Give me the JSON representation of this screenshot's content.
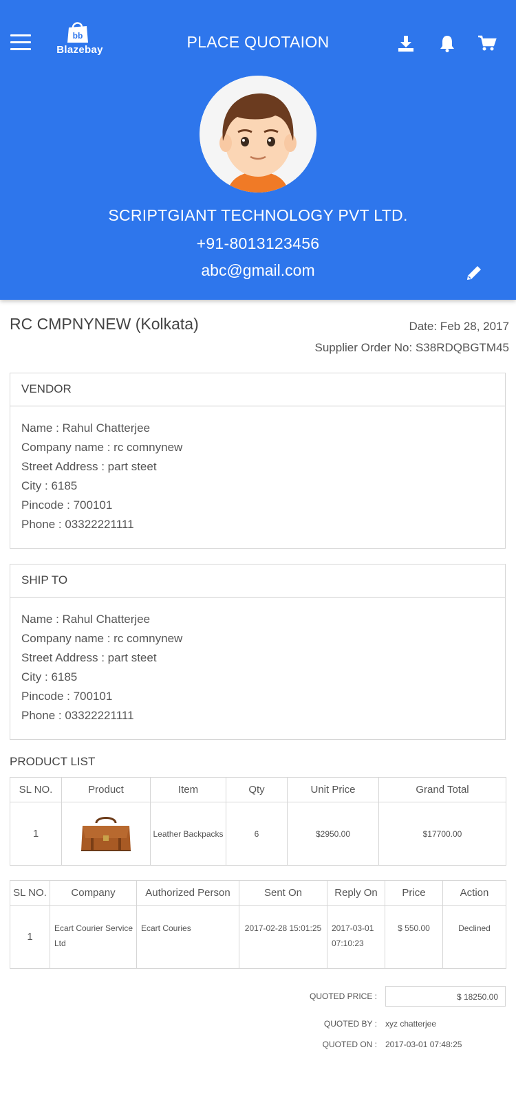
{
  "app": {
    "logo_text": "Blazebay",
    "title": "PLACE QUOTAION",
    "accent": "#2e76ec"
  },
  "header_icons": [
    "menu-icon",
    "download-icon",
    "bell-icon",
    "cart-icon",
    "pencil-icon"
  ],
  "profile": {
    "company": "SCRIPTGIANT TECHNOLOGY PVT LTD.",
    "phone": "+91-8013123456",
    "email": "abc@gmail.com"
  },
  "order": {
    "store_name": "RC CMPNYNEW (Kolkata)",
    "date": "Date: Feb 28, 2017",
    "supplier_order": "Supplier Order No: S38RDQBGTM45"
  },
  "vendor": {
    "heading": "VENDOR",
    "name": "Name : Rahul Chatterjee",
    "company": "Company name : rc comnynew",
    "street": "Street Address : part steet",
    "city": "City : 6185",
    "pincode": "Pincode : 700101",
    "phone": "Phone : 03322221111"
  },
  "ship_to": {
    "heading": "SHIP TO",
    "name": "Name : Rahul Chatterjee",
    "company": "Company name : rc comnynew",
    "street": "Street Address : part steet",
    "city": "City : 6185",
    "pincode": "Pincode : 700101",
    "phone": "Phone : 03322221111"
  },
  "product_list": {
    "title": "PRODUCT LIST",
    "headers": [
      "SL NO.",
      "Product",
      "Item",
      "Qty",
      "Unit Price",
      "Grand Total"
    ],
    "rows": [
      {
        "sl": "1",
        "product_image": "leather-bag-image",
        "item": "Leather Backpacks",
        "qty": "6",
        "unit_price": "$2950.00",
        "grand_total": "$17700.00"
      }
    ]
  },
  "quotes": {
    "headers": [
      "SL NO.",
      "Company",
      "Authorized Person",
      "Sent On",
      "Reply On",
      "Price",
      "Action"
    ],
    "rows": [
      {
        "sl": "1",
        "company": "Ecart Courier Service Ltd",
        "person": "Ecart Couries",
        "sent_on": "2017-02-28 15:01:25",
        "reply_on": "2017-03-01 07:10:23",
        "price": "$ 550.00",
        "action": "Declined"
      }
    ]
  },
  "summary": {
    "quoted_price_label": "QUOTED PRICE :",
    "quoted_price": "$ 18250.00",
    "quoted_by_label": "QUOTED BY :",
    "quoted_by": "xyz chatterjee",
    "quoted_on_label": "QUOTED ON :",
    "quoted_on": "2017-03-01 07:48:25"
  }
}
